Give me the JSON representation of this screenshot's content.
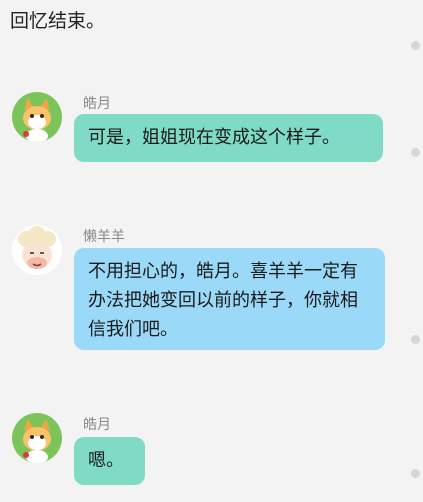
{
  "narration": "回忆结束。",
  "messages": [
    {
      "sender": "皓月",
      "avatar_icon": "cat-avatar-icon",
      "text": "可是，姐姐现在变成这个样子。",
      "bubble_color": "#7fdbc6"
    },
    {
      "sender": "懒羊羊",
      "avatar_icon": "sheep-avatar-icon",
      "text": "不用担心的，皓月。喜羊羊一定有办法把她变回以前的样子，你就相信我们吧。",
      "bubble_color": "#9ad9f8"
    },
    {
      "sender": "皓月",
      "avatar_icon": "cat-avatar-icon",
      "text": "嗯。",
      "bubble_color": "#7fdbc6"
    }
  ],
  "colors": {
    "background": "#f3f3f3",
    "sender_name": "#8a8a8a",
    "side_dot": "#d6d6d6"
  }
}
